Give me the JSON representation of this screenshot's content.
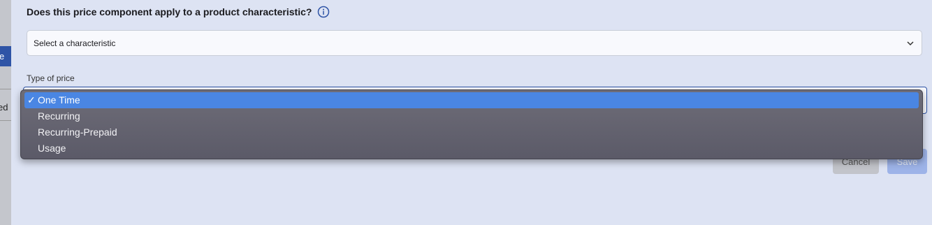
{
  "sidebar": {
    "active_item_fragment": "e",
    "item_fragment": "ed"
  },
  "dialog": {
    "question": "Does this price component apply to a product characteristic?",
    "characteristic_select": {
      "value": "Select a characteristic"
    },
    "price_type": {
      "label": "Type of price",
      "check_glyph": "✓",
      "options": [
        {
          "label": "One Time",
          "selected": true
        },
        {
          "label": "Recurring",
          "selected": false
        },
        {
          "label": "Recurring-Prepaid",
          "selected": false
        },
        {
          "label": "Usage",
          "selected": false
        }
      ]
    },
    "buttons": {
      "cancel": "Cancel",
      "save": "Save"
    }
  },
  "colors": {
    "accent": "#2f54a6",
    "selected_option": "#4a86e3",
    "background": "#dde3f3"
  }
}
